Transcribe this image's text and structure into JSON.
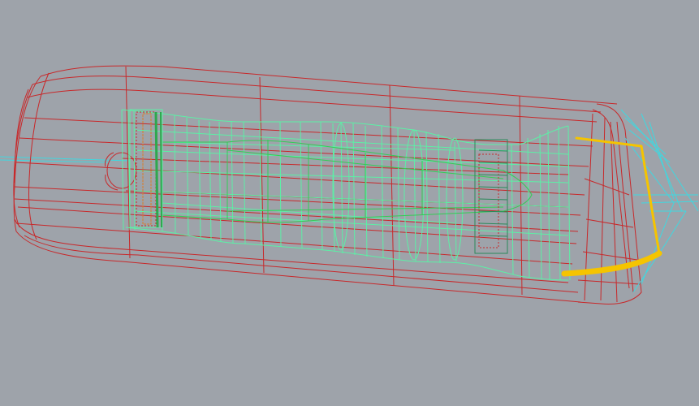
{
  "viewport": {
    "view": "wireframe-perspective",
    "background_color": "#9ea3aa"
  },
  "layers": {
    "outer_shell": {
      "color": "#c8282a"
    },
    "inner_structure": {
      "color": "#5cf0a6"
    },
    "inner_shaded_core": {
      "color": "#33cc55"
    },
    "axis_lines": {
      "color": "#3fd8e0"
    },
    "selection": {
      "color": "#f5c400"
    }
  },
  "axes": {
    "x_axis_color": "#3fd8e0"
  }
}
